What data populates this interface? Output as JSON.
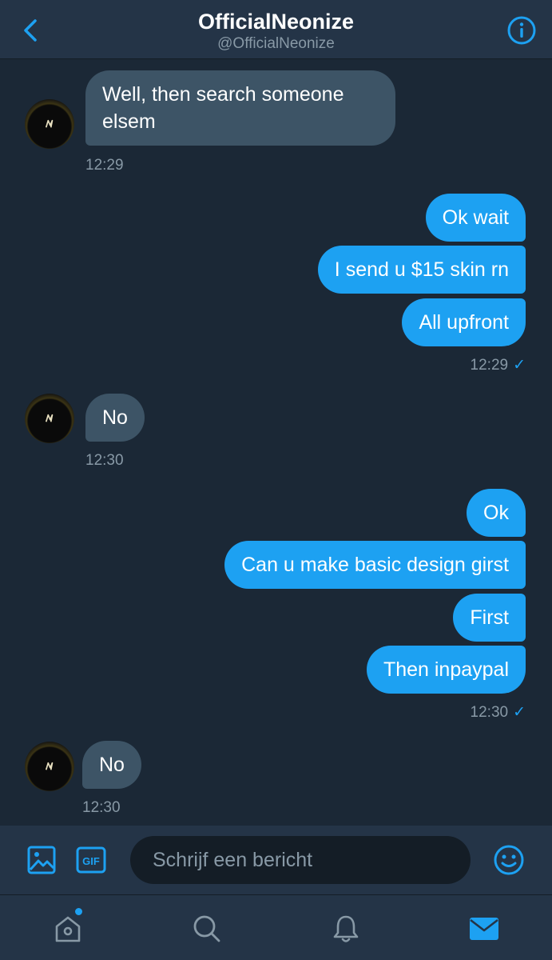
{
  "header": {
    "title": "OfficialNeonize",
    "handle": "@OfficialNeonize",
    "back_icon": "chevron-left-icon",
    "info_icon": "info-circle-icon"
  },
  "messages": [
    {
      "from": "them",
      "text": "Well, then search someone elsem",
      "time": "12:29"
    },
    {
      "from": "me",
      "texts": [
        "Ok wait",
        "I send u $15 skin rn",
        "All upfront"
      ],
      "time": "12:29"
    },
    {
      "from": "them",
      "text": "No",
      "time": "12:30"
    },
    {
      "from": "me",
      "texts": [
        "Ok",
        "Can u make basic design girst",
        "First",
        "Then inpaypal"
      ],
      "time": "12:30"
    },
    {
      "from": "them",
      "text": "No",
      "time": "12:30"
    }
  ],
  "read_receipt": "✓",
  "composer": {
    "placeholder": "Schrijf een bericht",
    "image_icon": "image-icon",
    "gif_icon": "gif-icon",
    "gif_label": "GIF",
    "emoji_icon": "emoji-icon"
  },
  "tabs": [
    {
      "name": "home",
      "icon": "home-icon",
      "has_dot": true
    },
    {
      "name": "search",
      "icon": "search-icon"
    },
    {
      "name": "notifications",
      "icon": "bell-icon"
    },
    {
      "name": "messages",
      "icon": "mail-icon",
      "active": true
    }
  ],
  "colors": {
    "accent": "#1da1f2",
    "background": "#1b2836",
    "bar": "#243447",
    "incoming_bubble": "#3d5466",
    "muted_text": "#8899a6"
  }
}
